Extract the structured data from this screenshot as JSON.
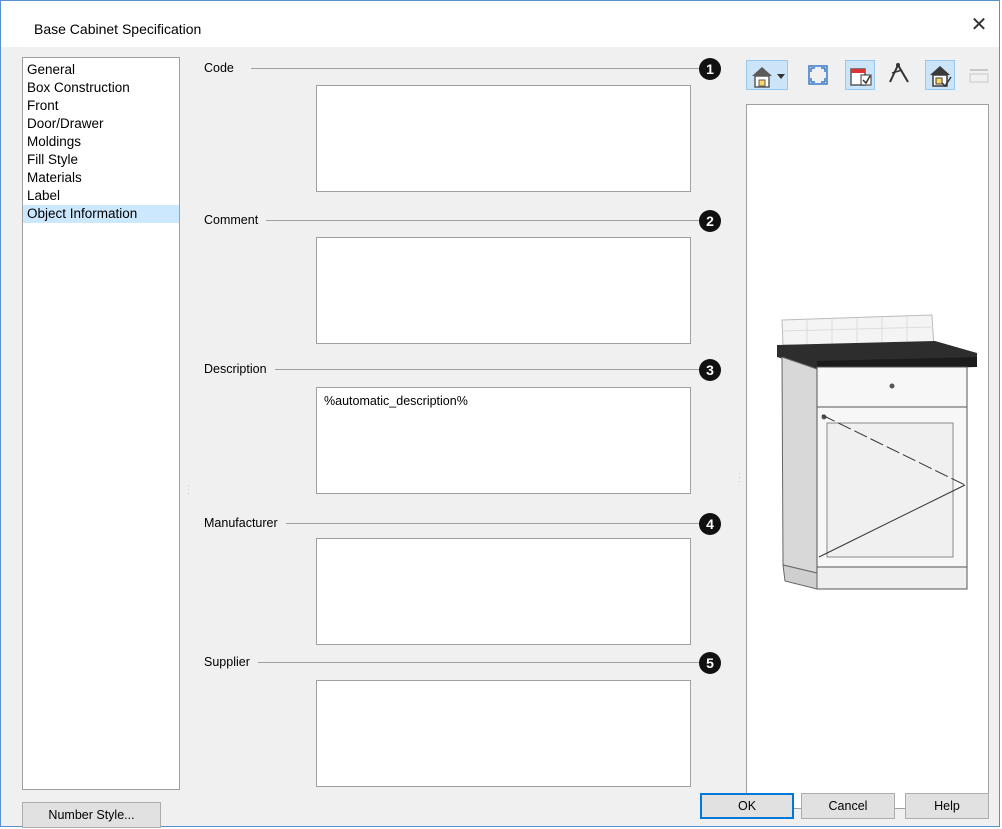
{
  "window": {
    "title": "Base Cabinet Specification",
    "close_glyph": "✕"
  },
  "nav": {
    "items": [
      {
        "label": "General"
      },
      {
        "label": "Box Construction"
      },
      {
        "label": "Front"
      },
      {
        "label": "Door/Drawer"
      },
      {
        "label": "Moldings"
      },
      {
        "label": "Fill Style"
      },
      {
        "label": "Materials"
      },
      {
        "label": "Label"
      },
      {
        "label": "Object Information"
      }
    ],
    "selected": "Object Information"
  },
  "fields": {
    "code": {
      "label": "Code",
      "value": "",
      "callout": "1"
    },
    "comment": {
      "label": "Comment",
      "value": "",
      "callout": "2"
    },
    "description": {
      "label": "Description",
      "value": "%automatic_description%",
      "callout": "3"
    },
    "manufacturer": {
      "label": "Manufacturer",
      "value": "",
      "callout": "4"
    },
    "supplier": {
      "label": "Supplier",
      "value": "",
      "callout": "5"
    }
  },
  "toolbar": {
    "icons": [
      "view-type-icon",
      "fill-window-icon",
      "3d-view-icon",
      "camera-orbit-icon",
      "render-icon",
      "reset-icon"
    ],
    "accent": "#cce4f7"
  },
  "buttons": {
    "number_style": "Number Style...",
    "ok": "OK",
    "cancel": "Cancel",
    "help": "Help"
  },
  "colors": {
    "selection": "#cce8ff",
    "default_button_border": "#0078d7",
    "countertop": "#2d2d2d"
  }
}
